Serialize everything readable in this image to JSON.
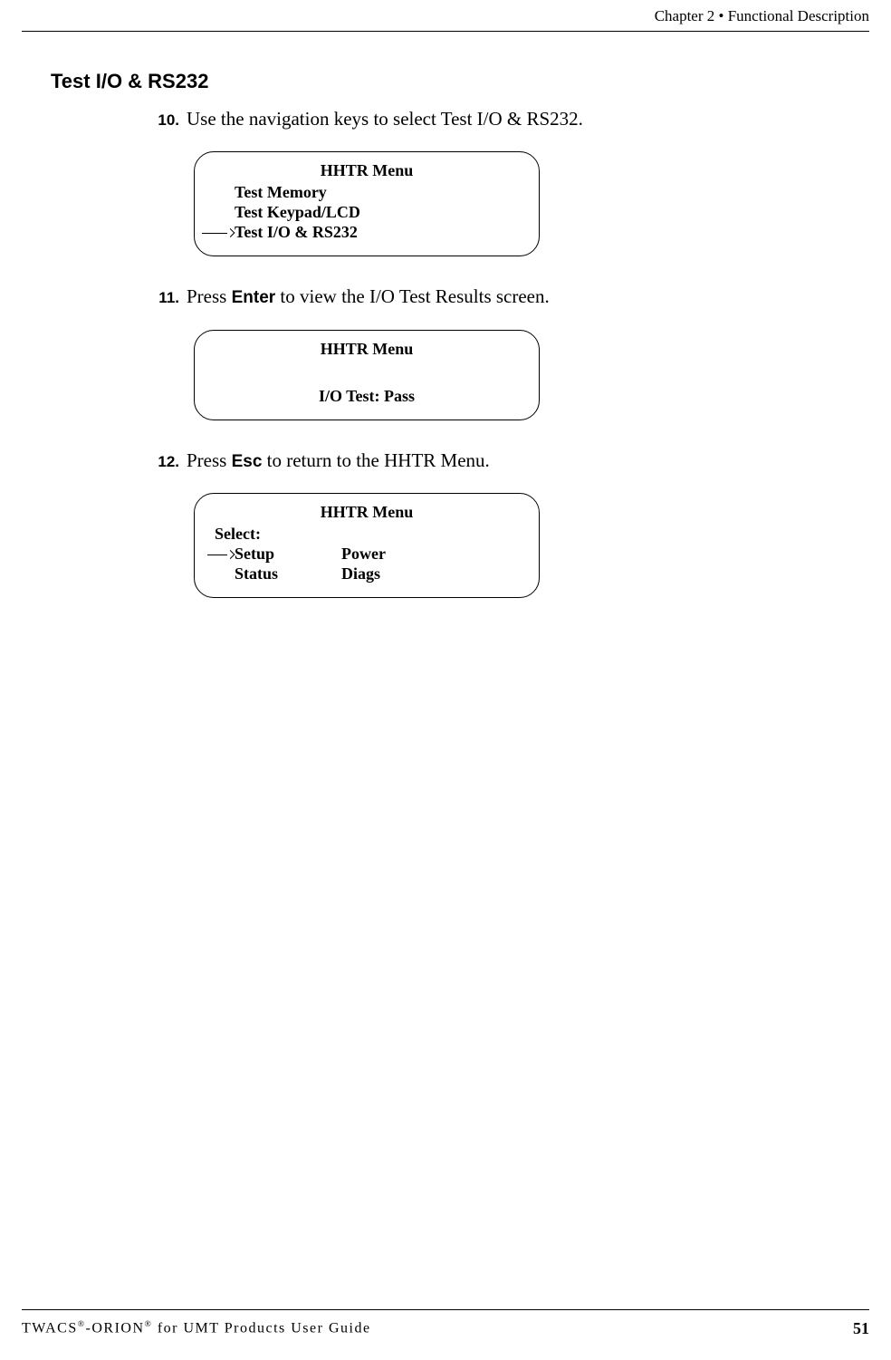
{
  "header": {
    "chapter": "Chapter 2 • Functional Description"
  },
  "section": {
    "title": "Test I/O & RS232"
  },
  "steps": {
    "s10": {
      "num": "10.",
      "text": "Use the navigation keys to select Test I/O & RS232."
    },
    "s11": {
      "num": "11.",
      "press": "Press ",
      "key": "Enter",
      "rest": " to view the I/O Test Results screen."
    },
    "s12": {
      "num": "12.",
      "press": "Press ",
      "key": "Esc",
      "rest": " to return to the HHTR Menu."
    }
  },
  "screens": {
    "a": {
      "title": "HHTR Menu",
      "lines": [
        "Test Memory",
        "Test Keypad/LCD",
        "Test I/O & RS232"
      ]
    },
    "b": {
      "title": "HHTR Menu",
      "result": "I/O Test:  Pass"
    },
    "c": {
      "title": "HHTR Menu",
      "select": "Select:",
      "col1": [
        "Setup",
        "Status"
      ],
      "col2": [
        "Power",
        "Diags"
      ]
    }
  },
  "footer": {
    "guide_a": "TWACS",
    "guide_b": "-ORION",
    "guide_c": " for UMT Products User Guide",
    "page": "51"
  }
}
